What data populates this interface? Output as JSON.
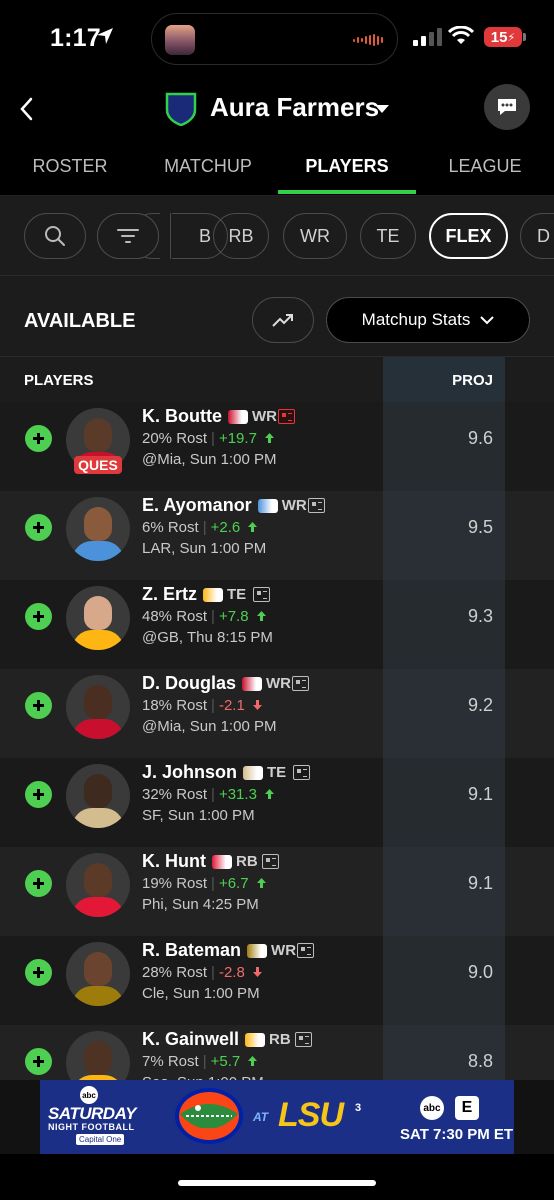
{
  "status_bar": {
    "time": "1:17",
    "battery": "15"
  },
  "header": {
    "team_name": "Aura Farmers"
  },
  "tabs": [
    "ROSTER",
    "MATCHUP",
    "PLAYERS",
    "LEAGUE"
  ],
  "active_tab": "PLAYERS",
  "filters": {
    "chips": [
      "B",
      "RB",
      "WR",
      "TE",
      "FLEX",
      "D"
    ],
    "active": "FLEX"
  },
  "available": {
    "title": "AVAILABLE",
    "stats_button": "Matchup Stats"
  },
  "table": {
    "players_header": "PLAYERS",
    "proj_header": "PROJ"
  },
  "players": [
    {
      "name": "K. Boutte",
      "pos": "WR",
      "rost": "20% Rost",
      "delta": "+19.7",
      "trend": "up",
      "game": "@Mia, Sun 1:00 PM",
      "proj": "9.6",
      "status": "QUES",
      "team_color": "#c8102e"
    },
    {
      "name": "E. Ayomanor",
      "pos": "WR",
      "rost": "6% Rost",
      "delta": "+2.6",
      "trend": "up",
      "game": "LAR, Sun 1:00 PM",
      "proj": "9.5",
      "status": "",
      "team_color": "#4b92db"
    },
    {
      "name": "Z. Ertz",
      "pos": "TE",
      "rost": "48% Rost",
      "delta": "+7.8",
      "trend": "up",
      "game": "@GB, Thu 8:15 PM",
      "proj": "9.3",
      "status": "",
      "team_color": "#ffb612"
    },
    {
      "name": "D. Douglas",
      "pos": "WR",
      "rost": "18% Rost",
      "delta": "-2.1",
      "trend": "down",
      "game": "@Mia, Sun 1:00 PM",
      "proj": "9.2",
      "status": "",
      "team_color": "#c8102e"
    },
    {
      "name": "J. Johnson",
      "pos": "TE",
      "rost": "32% Rost",
      "delta": "+31.3",
      "trend": "up",
      "game": "SF, Sun 1:00 PM",
      "proj": "9.1",
      "status": "",
      "team_color": "#d3bc8d"
    },
    {
      "name": "K. Hunt",
      "pos": "RB",
      "rost": "19% Rost",
      "delta": "+6.7",
      "trend": "up",
      "game": "Phi, Sun 4:25 PM",
      "proj": "9.1",
      "status": "",
      "team_color": "#e31837"
    },
    {
      "name": "R. Bateman",
      "pos": "WR",
      "rost": "28% Rost",
      "delta": "-2.8",
      "trend": "down",
      "game": "Cle, Sun 1:00 PM",
      "proj": "9.0",
      "status": "",
      "team_color": "#9e7c0c"
    },
    {
      "name": "K. Gainwell",
      "pos": "RB",
      "rost": "7% Rost",
      "delta": "+5.7",
      "trend": "up",
      "game": "Sea, Sun 1:00 PM",
      "proj": "8.8",
      "status": "",
      "team_color": "#ffb612"
    }
  ],
  "ad": {
    "show_top": "SATURDAY",
    "show_bottom": "NIGHT FOOTBALL",
    "sponsor": "Capital One",
    "at": "AT",
    "opponent": "LSU",
    "rank": "3",
    "network_abc": "abc",
    "network_espn": "E",
    "airtime": "SAT 7:30 PM ET"
  },
  "colors": {
    "accent_green": "#33d14a",
    "add_green": "#4ecf52",
    "down_red": "#ef6b6b",
    "status_red": "#e0393b"
  }
}
